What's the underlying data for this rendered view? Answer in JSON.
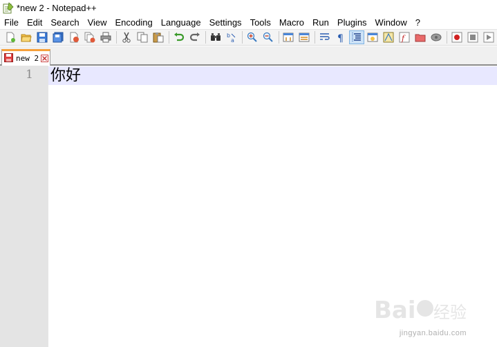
{
  "window": {
    "title": "*new 2 - Notepad++"
  },
  "menu": {
    "items": [
      {
        "label": "File"
      },
      {
        "label": "Edit"
      },
      {
        "label": "Search"
      },
      {
        "label": "View"
      },
      {
        "label": "Encoding"
      },
      {
        "label": "Language"
      },
      {
        "label": "Settings"
      },
      {
        "label": "Tools"
      },
      {
        "label": "Macro"
      },
      {
        "label": "Run"
      },
      {
        "label": "Plugins"
      },
      {
        "label": "Window"
      },
      {
        "label": "?"
      }
    ]
  },
  "toolbar": {
    "buttons": [
      {
        "icon": "new-file-icon"
      },
      {
        "icon": "open-file-icon"
      },
      {
        "icon": "save-icon"
      },
      {
        "icon": "save-all-icon"
      },
      {
        "icon": "close-icon"
      },
      {
        "icon": "close-all-icon"
      },
      {
        "icon": "print-icon"
      },
      {
        "icon": "cut-icon"
      },
      {
        "icon": "copy-icon"
      },
      {
        "icon": "paste-icon"
      },
      {
        "icon": "undo-icon"
      },
      {
        "icon": "redo-icon"
      },
      {
        "icon": "find-icon"
      },
      {
        "icon": "replace-icon"
      },
      {
        "icon": "zoom-in-icon"
      },
      {
        "icon": "zoom-out-icon"
      },
      {
        "icon": "sync-vertical-icon"
      },
      {
        "icon": "sync-horizontal-icon"
      },
      {
        "icon": "word-wrap-icon"
      },
      {
        "icon": "show-all-characters-icon"
      },
      {
        "icon": "indent-guide-icon"
      },
      {
        "icon": "language-udl-icon"
      },
      {
        "icon": "document-map-icon"
      },
      {
        "icon": "function-list-icon"
      },
      {
        "icon": "folder-as-workspace-icon"
      },
      {
        "icon": "monitoring-icon"
      },
      {
        "icon": "record-macro-icon"
      },
      {
        "icon": "stop-recording-icon"
      },
      {
        "icon": "playback-macro-icon"
      }
    ]
  },
  "tabs": [
    {
      "label": "new 2",
      "active": true,
      "modified": true
    }
  ],
  "editor": {
    "lines": [
      {
        "number": "1",
        "text": "你好"
      }
    ]
  },
  "watermark": {
    "text": "Baidu经验",
    "subtext": "jingyan.baidu.com"
  },
  "colors": {
    "current_line": "#e8e8ff",
    "gutter": "#e4e4e4",
    "tab_accent": "#f6a03b"
  }
}
